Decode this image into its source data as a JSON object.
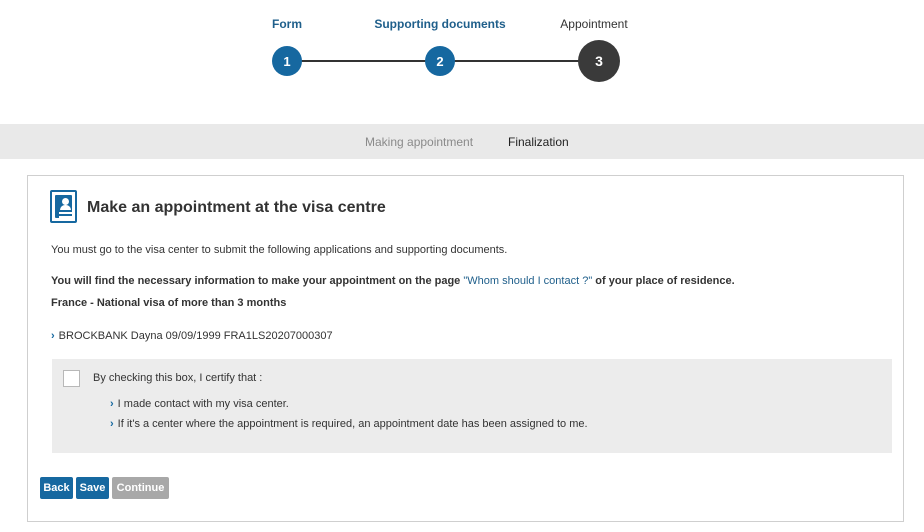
{
  "stepper": {
    "steps": [
      {
        "label": "Form",
        "number": "1",
        "state": "done"
      },
      {
        "label": "Supporting documents",
        "number": "2",
        "state": "done"
      },
      {
        "label": "Appointment",
        "number": "3",
        "state": "current"
      }
    ]
  },
  "subtabs": {
    "making_appointment": "Making appointment",
    "finalization": "Finalization"
  },
  "panel": {
    "title": "Make an appointment at the visa centre",
    "intro": "You must go to the visa center to submit the following applications and supporting documents.",
    "info_before": "You will find the necessary information to make your appointment on the page ",
    "info_link": "\"Whom should I contact ?\"",
    "info_after": " of your place of residence.",
    "visa_type": "France - National visa of more than 3 months",
    "applicant": "BROCKBANK Dayna 09/09/1999 FRA1LS20207000307",
    "certify": {
      "label": "By checking this box, I certify that :",
      "checked": false,
      "items": [
        "I made contact with my visa center.",
        "If it's a center where the appointment is required, an appointment date has been assigned to me."
      ]
    }
  },
  "buttons": {
    "back": "Back",
    "save": "Save",
    "continue": "Continue"
  },
  "colors": {
    "primary": "#1668a0",
    "current_step": "#3a3a3a",
    "disabled": "#a8a8a8",
    "link": "#1f5f8b"
  }
}
